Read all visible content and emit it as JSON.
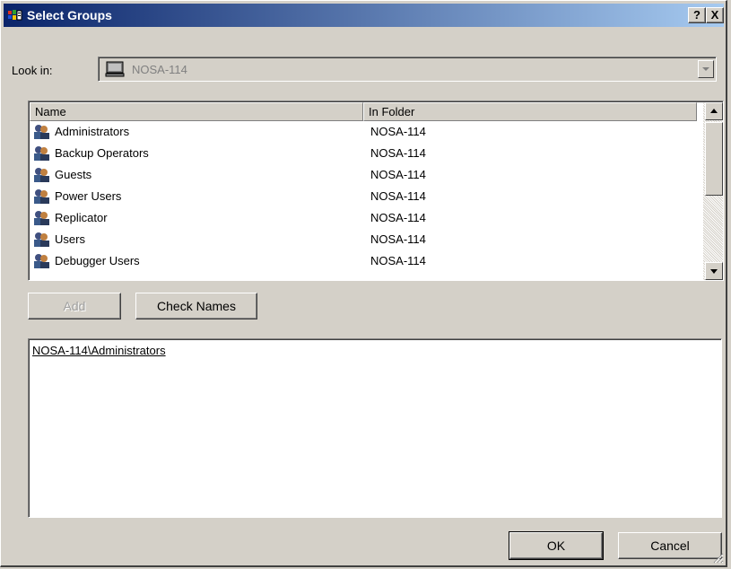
{
  "window": {
    "title": "Select Groups",
    "help_label": "?",
    "close_label": "X"
  },
  "lookin": {
    "label": "Look in:",
    "value": "NOSA-114"
  },
  "list": {
    "columns": [
      "Name",
      "In Folder"
    ],
    "rows": [
      {
        "name": "Administrators",
        "folder": "NOSA-114"
      },
      {
        "name": "Backup Operators",
        "folder": "NOSA-114"
      },
      {
        "name": "Guests",
        "folder": "NOSA-114"
      },
      {
        "name": "Power Users",
        "folder": "NOSA-114"
      },
      {
        "name": "Replicator",
        "folder": "NOSA-114"
      },
      {
        "name": "Users",
        "folder": "NOSA-114"
      },
      {
        "name": "Debugger Users",
        "folder": "NOSA-114"
      }
    ]
  },
  "buttons": {
    "add": "Add",
    "check_names": "Check Names",
    "ok": "OK",
    "cancel": "Cancel"
  },
  "selected": {
    "text": "NOSA-114\\Administrators"
  },
  "colors": {
    "title_start": "#0a246a",
    "title_end": "#a6caf0",
    "face": "#d4d0c8"
  },
  "icons": {
    "title": "windows-flag-icon",
    "lookin": "computer-icon",
    "row": "group-icon"
  }
}
